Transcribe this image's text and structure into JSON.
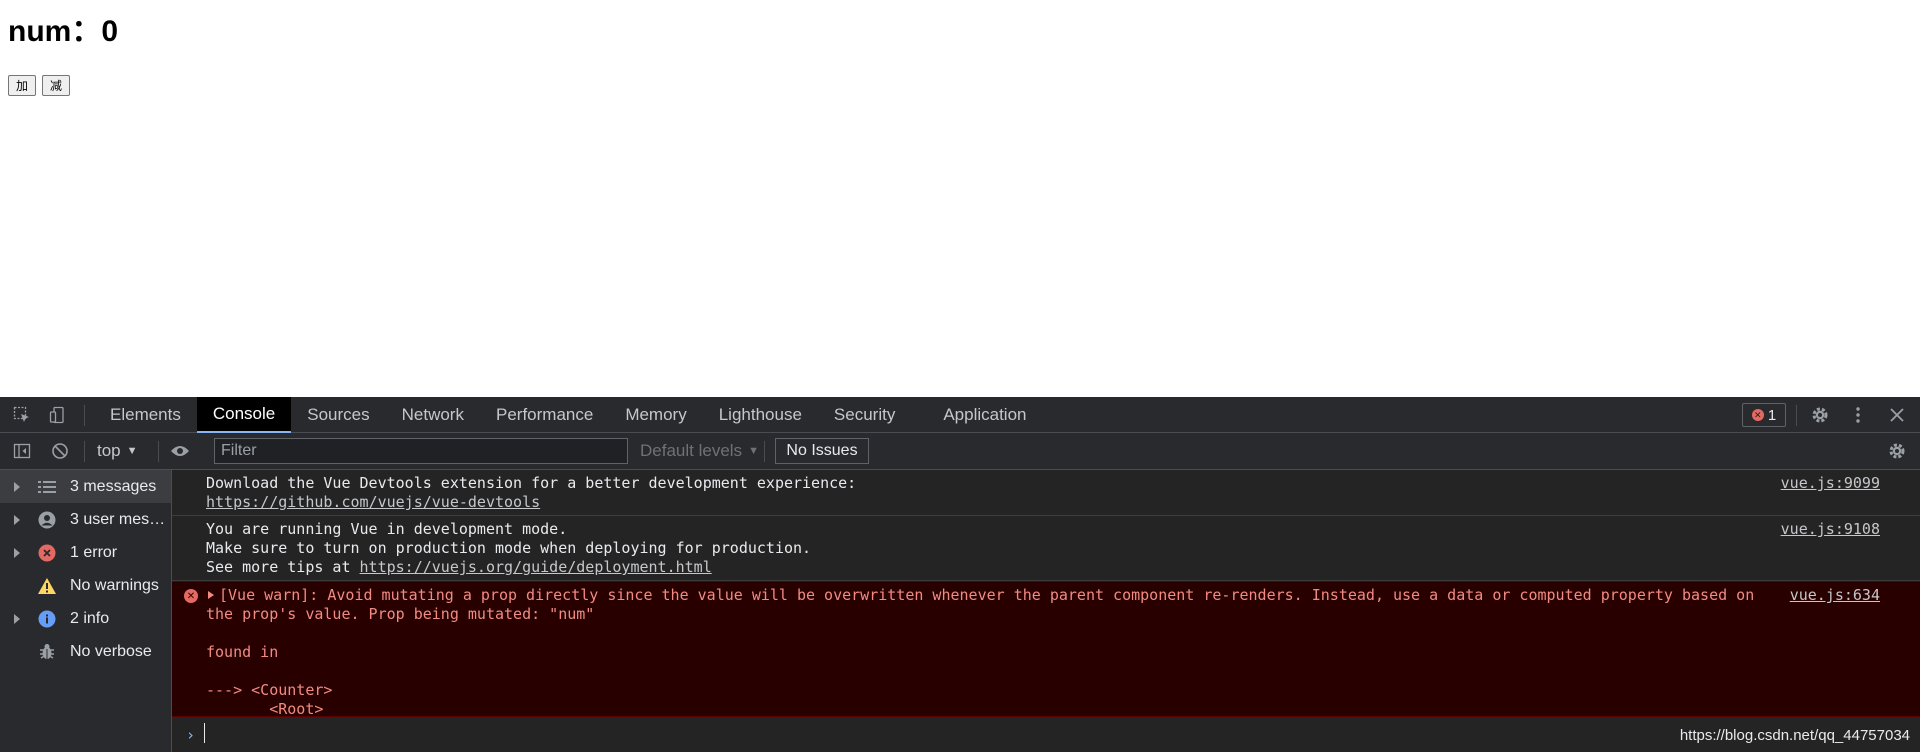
{
  "page": {
    "heading": "num：0",
    "buttons": {
      "add": "加",
      "subtract": "减"
    }
  },
  "devtools": {
    "tabs": [
      "Elements",
      "Console",
      "Sources",
      "Network",
      "Performance",
      "Memory",
      "Lighthouse",
      "Security",
      "Application"
    ],
    "active_tab": "Console",
    "error_badge_count": "1",
    "toolbar": {
      "context": "top",
      "filter_placeholder": "Filter",
      "levels": "Default levels",
      "issues": "No Issues"
    },
    "sidebar": [
      {
        "label": "3 messages",
        "icon": "list-icon",
        "expandable": true,
        "selected": true
      },
      {
        "label": "3 user mess...",
        "icon": "user-icon",
        "expandable": true,
        "selected": false
      },
      {
        "label": "1 error",
        "icon": "error-icon",
        "expandable": true,
        "selected": false
      },
      {
        "label": "No warnings",
        "icon": "warning-icon",
        "expandable": false,
        "selected": false
      },
      {
        "label": "2 info",
        "icon": "info-icon",
        "expandable": true,
        "selected": false
      },
      {
        "label": "No verbose",
        "icon": "bug-icon",
        "expandable": false,
        "selected": false
      }
    ],
    "messages": [
      {
        "lines": [
          "Download the Vue Devtools extension for a better development experience:"
        ],
        "link": "https://github.com/vuejs/vue-devtools",
        "source": "vue.js:9099"
      },
      {
        "lines": [
          "You are running Vue in development mode.",
          "Make sure to turn on production mode when deploying for production."
        ],
        "prefix": "See more tips at ",
        "link": "https://vuejs.org/guide/deployment.html",
        "source": "vue.js:9108"
      },
      {
        "lines": [
          "[Vue warn]: Avoid mutating a prop directly since the value will be overwritten whenever the parent component re-renders. Instead, use a data or computed property based on",
          "the prop's value. Prop being mutated: \"num\"",
          "",
          "found in",
          "",
          "---> <Counter>",
          "       <Root>"
        ],
        "source": "vue.js:634",
        "level": "error"
      }
    ],
    "watermark": "https://blog.csdn.net/qq_44757034"
  }
}
